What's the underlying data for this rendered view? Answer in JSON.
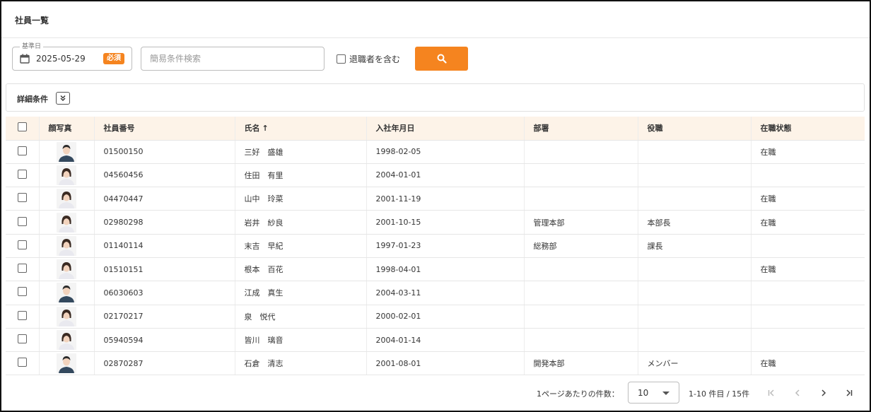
{
  "page": {
    "title": "社員一覧"
  },
  "search": {
    "date_legend": "基準日",
    "date_value": "2025-05-29",
    "required_badge": "必須",
    "keyword_placeholder": "簡易条件検索",
    "include_retired_label": "退職者を含む"
  },
  "detail": {
    "label": "詳細条件"
  },
  "table": {
    "headers": {
      "photo": "顔写真",
      "employee_no": "社員番号",
      "name": "氏名",
      "sort_indicator": "↑",
      "join_date": "入社年月日",
      "department": "部署",
      "position": "役職",
      "status": "在職状態"
    },
    "rows": [
      {
        "employee_no": "01500150",
        "name": "三好　盛雄",
        "join_date": "1998-02-05",
        "department": "",
        "position": "",
        "status": "在職",
        "avatar": "male"
      },
      {
        "employee_no": "04560456",
        "name": "住田　有里",
        "join_date": "2004-01-01",
        "department": "",
        "position": "",
        "status": "",
        "avatar": "female"
      },
      {
        "employee_no": "04470447",
        "name": "山中　玲菜",
        "join_date": "2001-11-19",
        "department": "",
        "position": "",
        "status": "在職",
        "avatar": "female"
      },
      {
        "employee_no": "02980298",
        "name": "岩井　紗良",
        "join_date": "2001-10-15",
        "department": "管理本部",
        "position": "本部長",
        "status": "在職",
        "avatar": "female"
      },
      {
        "employee_no": "01140114",
        "name": "末吉　早紀",
        "join_date": "1997-01-23",
        "department": "総務部",
        "position": "課長",
        "status": "",
        "avatar": "female"
      },
      {
        "employee_no": "01510151",
        "name": "根本　百花",
        "join_date": "1998-04-01",
        "department": "",
        "position": "",
        "status": "在職",
        "avatar": "female"
      },
      {
        "employee_no": "06030603",
        "name": "江成　真生",
        "join_date": "2004-03-11",
        "department": "",
        "position": "",
        "status": "",
        "avatar": "male"
      },
      {
        "employee_no": "02170217",
        "name": "泉　悦代",
        "join_date": "2000-02-01",
        "department": "",
        "position": "",
        "status": "",
        "avatar": "female"
      },
      {
        "employee_no": "05940594",
        "name": "皆川　璃音",
        "join_date": "2004-01-14",
        "department": "",
        "position": "",
        "status": "",
        "avatar": "female"
      },
      {
        "employee_no": "02870287",
        "name": "石倉　清志",
        "join_date": "2001-08-01",
        "department": "開発本部",
        "position": "メンバー",
        "status": "在職",
        "avatar": "male"
      }
    ]
  },
  "pager": {
    "per_page_label": "1ページあたりの件数：",
    "per_page_value": "10",
    "range_label": "1-10 件目 / 15件"
  },
  "colors": {
    "accent": "#f5841f",
    "header_bg": "#fdf3e8"
  }
}
